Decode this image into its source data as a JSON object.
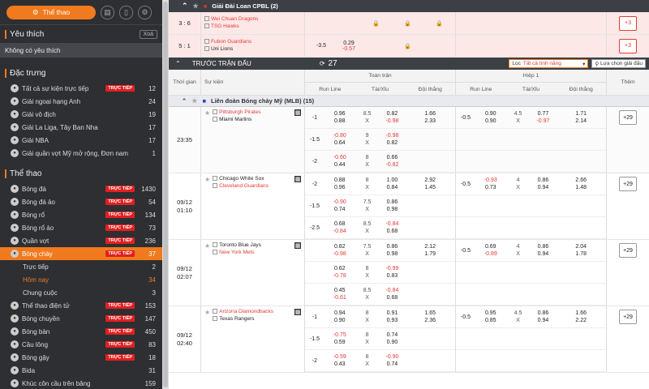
{
  "sidebar": {
    "sport_button": "Thể thao",
    "fav_title": "Yêu thích",
    "clear": "Xoá",
    "fav_empty": "Không có yêu thích",
    "featured_title": "Đặc trưng",
    "featured": [
      {
        "label": "Tất cả sự kiện trực tiếp",
        "live": "TRỰC TIẾP",
        "count": "12"
      },
      {
        "label": "Giải ngoại hạng Anh",
        "count": "24"
      },
      {
        "label": "Giải vô địch",
        "count": "19"
      },
      {
        "label": "Giải La Liga, Tây Ban Nha",
        "count": "17"
      },
      {
        "label": "Giải NBA",
        "count": "17"
      },
      {
        "label": "Giải quần vợt Mỹ mở rộng, Đơn nam",
        "count": "1"
      }
    ],
    "sports_title": "Thể thao",
    "sports": [
      {
        "label": "Bóng đá",
        "live": "TRỰC TIẾP",
        "count": "1430"
      },
      {
        "label": "Bóng đá ảo",
        "live": "TRỰC TIẾP",
        "count": "54"
      },
      {
        "label": "Bóng rổ",
        "live": "TRỰC TIẾP",
        "count": "134"
      },
      {
        "label": "Bóng rổ ảo",
        "live": "TRỰC TIẾP",
        "count": "73"
      },
      {
        "label": "Quần vợt",
        "live": "TRỰC TIẾP",
        "count": "236"
      },
      {
        "label": "Bóng chày",
        "live": "TRỰC TIẾP",
        "count": "37"
      }
    ],
    "baseball_sub": [
      {
        "label": "Trực tiếp",
        "count": "2"
      },
      {
        "label": "Hôm nay",
        "count": "34"
      },
      {
        "label": "Chung cuộc",
        "count": "3"
      }
    ],
    "sports2": [
      {
        "label": "Thể thao điện tử",
        "live": "TRỰC TIẾP",
        "count": "153"
      },
      {
        "label": "Bóng chuyền",
        "live": "TRỰC TIẾP",
        "count": "147"
      },
      {
        "label": "Bóng bàn",
        "live": "TRỰC TIẾP",
        "count": "450"
      },
      {
        "label": "Cầu lông",
        "live": "TRỰC TIẾP",
        "count": "83"
      },
      {
        "label": "Bóng gậy",
        "live": "TRỰC TIẾP",
        "count": "18"
      },
      {
        "label": "Bida",
        "count": "31"
      },
      {
        "label": "Khúc côn cầu trên băng",
        "count": "159"
      }
    ]
  },
  "tw_league": {
    "title": "Giải Đài Loan CPBL (2)"
  },
  "tw_rows": [
    {
      "score": "3 : 6",
      "home": "Wei Chuan Dragons",
      "away": "TSG Hawks",
      "plus": "+3"
    },
    {
      "score": "5 : 1",
      "home": "Fubon Guardians",
      "away": "Uni Lions",
      "line": "-3.5",
      "o1": "0.29",
      "o2": "-0.57",
      "plus": "+3"
    }
  ],
  "pre": {
    "title": "TRƯỚC TRẬN ĐẤU",
    "refresh": "27",
    "filter_label": "Lọc",
    "filter_value": "Tất cả tính năng",
    "pick_btn": "Lựa chọn giải đấu"
  },
  "cols": {
    "time": "Thời gian",
    "event": "Sự kiện",
    "full": "Toàn trận",
    "half": "Hiệp 1",
    "more": "Thêm",
    "runline": "Run Line",
    "ou": "Tài/Xỉu",
    "win": "Đội thắng"
  },
  "mlb": {
    "title": "Liên đoàn Bóng chày Mỹ (MLB) (15)"
  },
  "games": [
    {
      "time": "23:35",
      "home": "Pittsburgh Pirates",
      "away": "Miami Marlins",
      "plus": "+29",
      "lines": [
        {
          "rl": "-1",
          "rl1": "0.96",
          "rl2": "0.88",
          "ou": "8.5",
          "ouX": "X",
          "o1": "0.82",
          "o2": "-0.98",
          "w1": "1.66",
          "w2": "2.33",
          "h_rl": "-0.5",
          "h1": "0.90",
          "h2": "0.90",
          "h_ou": "4.5",
          "hX": "X",
          "ho1": "0.77",
          "ho2": "-0.97",
          "hw1": "1.71",
          "hw2": "2.14"
        },
        {
          "rl": "-1.5",
          "rl1": "-0.80",
          "rl2": "0.64",
          "ou": "9",
          "ouX": "X",
          "o1": "-0.98",
          "o2": "0.82"
        },
        {
          "rl": "-2",
          "rl1": "-0.60",
          "rl2": "0.44",
          "ou": "8",
          "ouX": "X",
          "o1": "0.66",
          "o2": "-0.82"
        }
      ]
    },
    {
      "time": "09/12 01:10",
      "home": "Chicago White Sox",
      "away": "Cleveland Guardians",
      "plus": "+29",
      "lines": [
        {
          "rl": "-2",
          "rl1": "0.88",
          "rl2": "0.96",
          "ou": "8",
          "ouX": "X",
          "o1": "1.00",
          "o2": "0.84",
          "w1": "2.92",
          "w2": "1.45",
          "h_rl": "-0.5",
          "h1": "-0.93",
          "h2": "0.73",
          "h_ou": "4",
          "hX": "X",
          "ho1": "0.86",
          "ho2": "0.94",
          "hw1": "2.66",
          "hw2": "1.48"
        },
        {
          "rl": "-1.5",
          "rl1": "-0.90",
          "rl2": "0.74",
          "ou": "7.5",
          "ouX": "X",
          "o1": "0.86",
          "o2": "0.98"
        },
        {
          "rl": "-2.5",
          "rl1": "0.68",
          "rl2": "-0.84",
          "ou": "8.5",
          "ouX": "X",
          "o1": "-0.84",
          "o2": "0.68"
        }
      ]
    },
    {
      "time": "09/12 02:07",
      "home": "Toronto Blue Jays",
      "away": "New York Mets",
      "plus": "+29",
      "lines": [
        {
          "rl": "",
          "rl1": "0.82",
          "rl2": "-0.98",
          "ou": "7.5",
          "ouX": "X",
          "o1": "0.86",
          "o2": "0.98",
          "w1": "2.12",
          "w2": "1.79",
          "h_rl": "-0.5",
          "h1": "0.69",
          "h2": "-0.89",
          "h_ou": "4",
          "hX": "X",
          "ho1": "0.86",
          "ho2": "0.94",
          "hw1": "2.04",
          "hw2": "1.78"
        },
        {
          "rl": "",
          "rl1": "0.62",
          "rl2": "-0.78",
          "ou": "8",
          "ouX": "X",
          "o1": "-0.99",
          "o2": "0.83"
        },
        {
          "rl": "",
          "rl1": "0.45",
          "rl2": "-0.61",
          "ou": "8.5",
          "ouX": "X",
          "o1": "-0.84",
          "o2": "0.68"
        }
      ]
    },
    {
      "time": "09/12 02:40",
      "home": "Arizona Diamondbacks",
      "away": "Texas Rangers",
      "plus": "+29",
      "lines": [
        {
          "rl": "-1",
          "rl1": "0.94",
          "rl2": "0.90",
          "ou": "8",
          "ouX": "X",
          "o1": "0.91",
          "o2": "0.93",
          "w1": "1.65",
          "w2": "2.36",
          "h_rl": "-0.5",
          "h1": "0.95",
          "h2": "0.85",
          "h_ou": "4.5",
          "hX": "X",
          "ho1": "0.86",
          "ho2": "0.94",
          "hw1": "1.66",
          "hw2": "2.22"
        },
        {
          "rl": "-1.5",
          "rl1": "-0.75",
          "rl2": "0.59",
          "ou": "8",
          "ouX": "X",
          "o1": "0.74",
          "o2": "0.90"
        },
        {
          "rl": "-2",
          "rl1": "-0.59",
          "rl2": "0.43",
          "ou": "8",
          "ouX": "X",
          "o1": "-0.90",
          "o2": "0.74"
        }
      ]
    }
  ]
}
